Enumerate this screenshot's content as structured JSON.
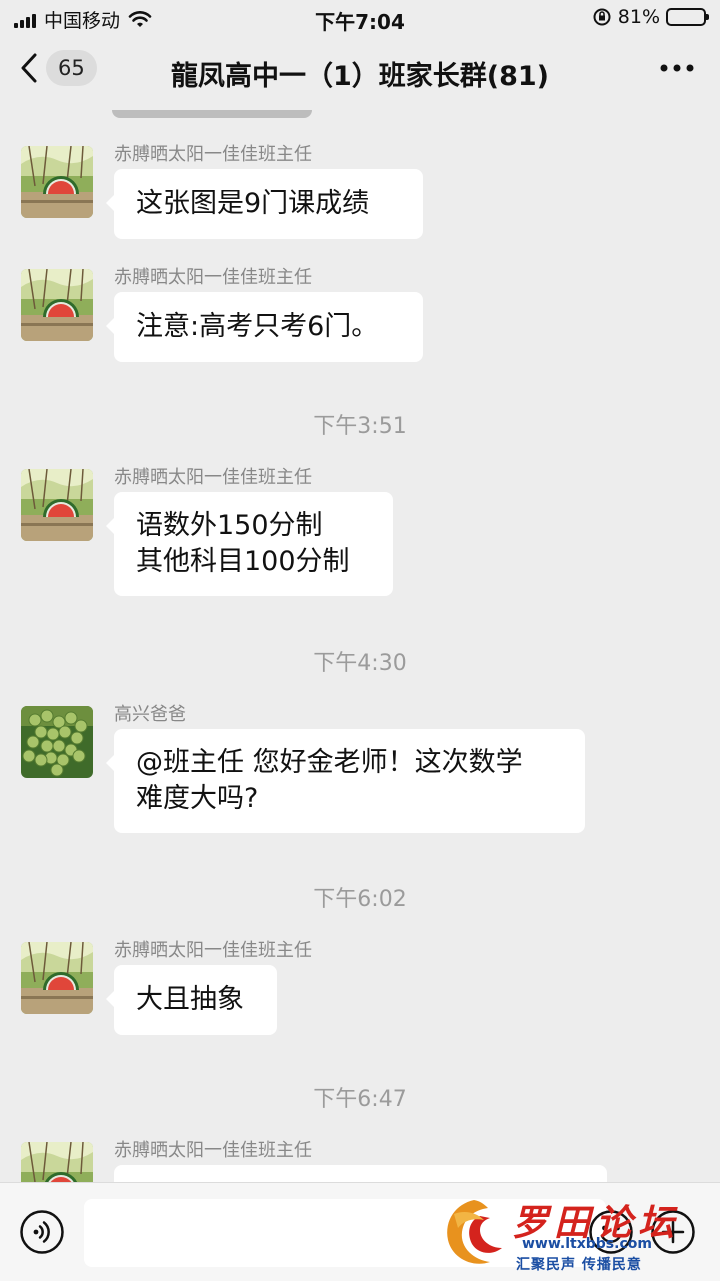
{
  "status_bar": {
    "carrier": "中国移动",
    "time": "下午7:04",
    "battery": "81%",
    "battery_level": 0.81
  },
  "nav": {
    "unread_count": "65",
    "title": "龍凤高中一（1）班家长群(81)"
  },
  "messages": [
    {
      "sender": "赤膊晒太阳一佳佳班主任",
      "lines": [
        "这张图是9门课成绩"
      ],
      "avatar": "watermelon-avatar"
    },
    {
      "sender": "赤膊晒太阳一佳佳班主任",
      "lines": [
        "注意:高考只考6门。"
      ],
      "avatar": "watermelon-avatar"
    },
    {
      "timestamp": "下午3:51"
    },
    {
      "sender": "赤膊晒太阳一佳佳班主任",
      "lines": [
        "语数外150分制",
        "其他科目100分制"
      ],
      "avatar": "watermelon-avatar"
    },
    {
      "timestamp": "下午4:30"
    },
    {
      "sender": "高兴爸爸",
      "lines": [
        "@班主任 您好金老师！这次数学",
        "难度大吗?"
      ],
      "avatar": "grapes-avatar"
    },
    {
      "timestamp": "下午6:02"
    },
    {
      "sender": "赤膊晒太阳一佳佳班主任",
      "lines": [
        "大且抽象"
      ],
      "avatar": "watermelon-avatar"
    },
    {
      "timestamp": "下午6:47"
    },
    {
      "sender": "赤膊晒太阳一佳佳班主任",
      "lines": [],
      "avatar": "watermelon-avatar"
    }
  ],
  "input": {
    "placeholder": ""
  },
  "watermark": {
    "title": "罗田论坛",
    "url": "www.ltxbbs.com",
    "slogan": "汇聚民声 传播民意"
  },
  "colors": {
    "background": "#ededed",
    "bubble": "#ffffff",
    "timestamp": "#9b9b9b",
    "sender": "#888888",
    "watermark_red": "#d4231d",
    "watermark_blue": "#1b4ea3"
  }
}
